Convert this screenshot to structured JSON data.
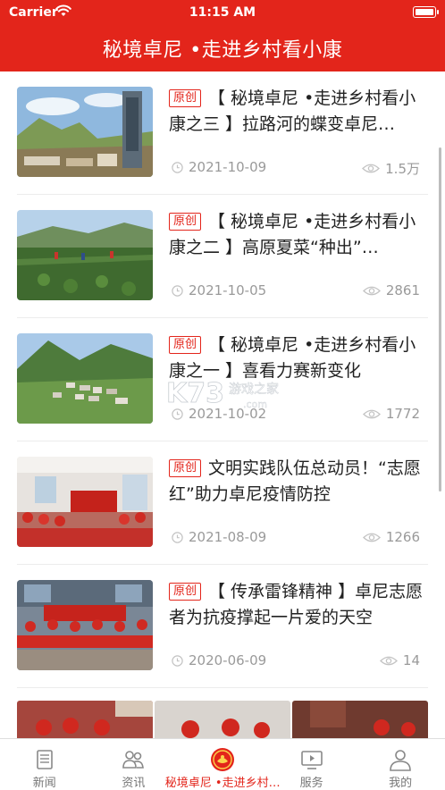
{
  "status_bar": {
    "carrier": "Carrier",
    "time": "11:15 AM",
    "battery_level": 1.0
  },
  "header": {
    "title": "秘境卓尼 •走进乡村看小康"
  },
  "articles": [
    {
      "badge": "原创",
      "title": "【 秘境卓尼 •走进乡村看小康之三 】拉路河的蝶变卓尼…",
      "date": "2021-10-09",
      "views": "1.5万"
    },
    {
      "badge": "原创",
      "title": "【 秘境卓尼 •走进乡村看小康之二 】高原夏菜“种出”…",
      "date": "2021-10-05",
      "views": "2861"
    },
    {
      "badge": "原创",
      "title": "【 秘境卓尼 •走进乡村看小康之一 】喜看力赛新变化",
      "date": "2021-10-02",
      "views": "1772"
    },
    {
      "badge": "原创",
      "title": "文明实践队伍总动员！“志愿红”助力卓尼疫情防控",
      "date": "2021-08-09",
      "views": "1266"
    },
    {
      "badge": "原创",
      "title": "【 传承雷锋精神 】卓尼志愿者为抗疫撑起一片爱的天空",
      "date": "2020-06-09",
      "views": "14"
    }
  ],
  "watermark": {
    "text": "K73",
    "sub": "游戏之家",
    "url": ".com"
  },
  "tabs": [
    {
      "label": "新闻",
      "icon": "newspaper-icon",
      "active": false
    },
    {
      "label": "资讯",
      "icon": "people-icon",
      "active": false
    },
    {
      "label": "秘境卓尼 •走进乡村…",
      "icon": "emblem-icon",
      "active": true
    },
    {
      "label": "服务",
      "icon": "play-screen-icon",
      "active": false
    },
    {
      "label": "我的",
      "icon": "user-icon",
      "active": false
    }
  ],
  "colors": {
    "brand_red": "#e3251b",
    "meta_gray": "#9a9a9a",
    "text_dark": "#222222"
  }
}
